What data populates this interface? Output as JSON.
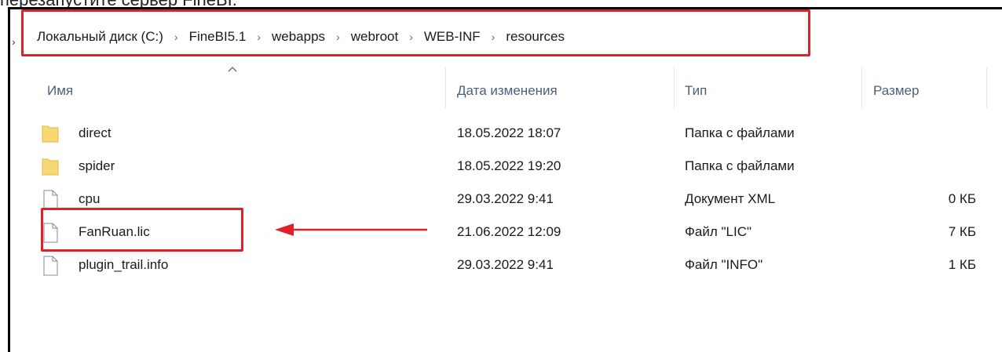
{
  "caption": "перезапустите сервер FineBI.",
  "breadcrumb": {
    "items": [
      "Локальный диск (C:)",
      "FineBI5.1",
      "webapps",
      "webroot",
      "WEB-INF",
      "resources"
    ],
    "separator": "›"
  },
  "columns": {
    "name": "Имя",
    "date": "Дата изменения",
    "type": "Тип",
    "size": "Размер"
  },
  "files": [
    {
      "name": "direct",
      "date": "18.05.2022 18:07",
      "type": "Папка с файлами",
      "size": "",
      "icon": "folder-icon"
    },
    {
      "name": "spider",
      "date": "18.05.2022 19:20",
      "type": "Папка с файлами",
      "size": "",
      "icon": "folder-icon"
    },
    {
      "name": "cpu",
      "date": "29.03.2022 9:41",
      "type": "Документ XML",
      "size": "0 КБ",
      "icon": "file-icon"
    },
    {
      "name": "FanRuan.lic",
      "date": "21.06.2022 12:09",
      "type": "Файл \"LIC\"",
      "size": "7 КБ",
      "icon": "file-icon"
    },
    {
      "name": "plugin_trail.info",
      "date": "29.03.2022 9:41",
      "type": "Файл \"INFO\"",
      "size": "1 КБ",
      "icon": "file-icon"
    }
  ],
  "colors": {
    "highlight": "#e0202a",
    "folder": "#f8d775",
    "header_text": "#4c607a"
  }
}
